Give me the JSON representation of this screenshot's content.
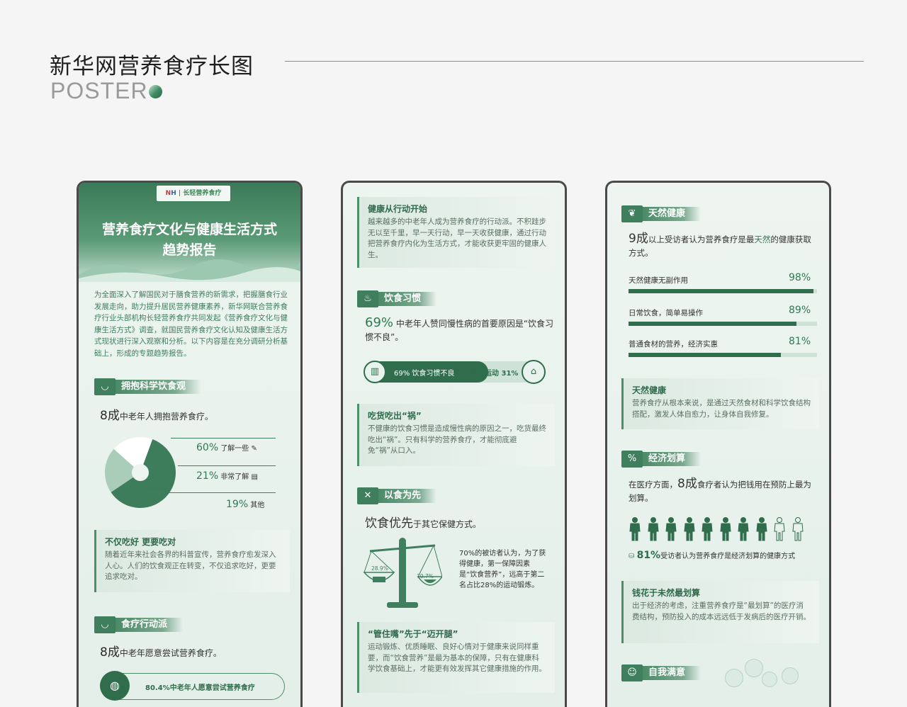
{
  "header": {
    "title": "新华网营养食疗长图",
    "subtitle": "POSTER"
  },
  "phone1": {
    "logo_text": "长轻营养食疗",
    "title_line1": "营养食疗文化与健康生活方式",
    "title_line2": "趋势报告",
    "intro": "为全面深入了解国民对于膳食营养的新需求，把握膳食行业发展走向，助力提升居民营养健康素养，新华网联合营养食疗行业头部机构长轻营养食疗共同发起《营养食疗文化与健康生活方式》调查，就国民营养食疗文化认知及健康生活方式现状进行深入观察和分析。以下内容是在充分调研分析基础上，形成的专题趋势报告。",
    "section1": "拥抱科学饮食观",
    "stat1_big": "8成",
    "stat1_text": "中老年人拥抱营养食疗。",
    "pie": [
      {
        "pct": "60%",
        "label": "了解一些",
        "value": 60,
        "color": "#3d7d5b"
      },
      {
        "pct": "21%",
        "label": "非常了解",
        "value": 21,
        "color": "#a9cdb8"
      },
      {
        "pct": "19%",
        "label": "其他",
        "value": 19,
        "color": "#ffffff"
      }
    ],
    "card1_title": "不仅吃好 更要吃对",
    "card1_body": "随着近年来社会各界的科普宣传，营养食疗愈发深入人心。人们的饮食观正在转变，不仅追求吃好，更要追求吃对。",
    "section2": "食疗行动派",
    "stat2_big": "8成",
    "stat2_text": "中老年愿意尝试营养食疗。",
    "pill_text": "80.4%中老年人愿意尝试营养食疗"
  },
  "phone2": {
    "card1_title": "健康从行动开始",
    "card1_body": "越来越多的中老年人成为营养食疗的行动派。不积跬步无以至千里，早一天行动，早一天收获健康，通过行动把营养食疗内化为生活方式，才能收获更牢固的健康人生。",
    "section1": "饮食习惯",
    "stat1_big": "69%",
    "stat1_text": "中老年人赞同慢性病的首要原因是“饮食习惯不良”。",
    "pill_left": "69% 饮食习惯不良",
    "pill_right": "缺乏运动 31%",
    "pill_value": 69,
    "card2_title": "吃货吃出“祸”",
    "card2_body": "不健康的饮食习惯是造成慢性病的原因之一，吃货最终吃出“祸”。只有科学的营养食疗，才能彻底避免“祸”从口入。",
    "section2": "以食为先",
    "stat2_big": "饮食优先",
    "stat2_text": "于其它保健方式。",
    "scale_left": "28.9%",
    "scale_right": "70.7%",
    "scale_text": "70%的被访者认为，为了获得健康，第一保障因素是“饮食营养”，远高于第二名占比28%的运动锻炼。",
    "card3_title": "“管住嘴”先于“迈开腿”",
    "card3_body": "运动锻炼、优质睡眠、良好心情对于健康来说同样重要，而“饮食营养”是最为基本的保障，只有在健康科学饮食基础上，才能更有效发挥其它健康措施的作用。"
  },
  "phone3": {
    "section1": "天然健康",
    "stat1_big": "9成",
    "stat1_text_a": "以上受访者认为营养食疗是最",
    "stat1_text_hl": "天然",
    "stat1_text_b": "的健康获取方式。",
    "bars": [
      {
        "label": "天然健康无副作用",
        "pct": "98%",
        "value": 98
      },
      {
        "label": "日常饮食，简单易操作",
        "pct": "89%",
        "value": 89
      },
      {
        "label": "普通食材的营养，经济实惠",
        "pct": "81%",
        "value": 81
      }
    ],
    "card1_title": "天然健康",
    "card1_body": "营养食疗从根本来说，是通过天然食材和科学饮食结构搭配，激发人体自愈力，让身体自我修复。",
    "section2": "经济划算",
    "stat2_pre": "在医疗方面，",
    "stat2_big": "8成",
    "stat2_text": "食疗者认为把钱用在预防上最为划算。",
    "people_filled": 8,
    "people_total": 10,
    "stat3_big": "81%",
    "stat3_text": "受访者认为营养食疗是经济划算的健康方式",
    "card2_title": "钱花于未然最划算",
    "card2_body": "出于经济的考虑，注重营养食疗是“最划算”的医疗消费结构，预防投入的成本远远低于发病后的医疗开销。",
    "section3": "自我满意"
  }
}
